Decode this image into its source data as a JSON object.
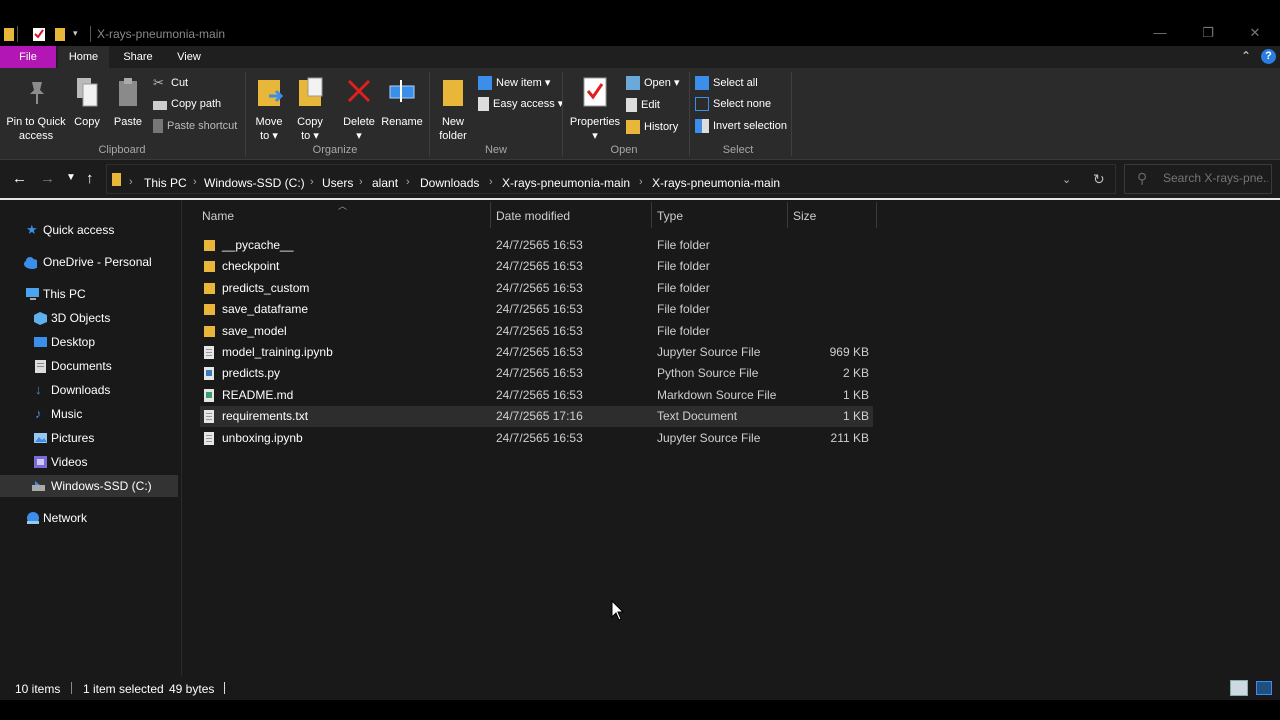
{
  "window": {
    "title": "X-rays-pneumonia-main"
  },
  "ribbon_tabs": {
    "file": "File",
    "home": "Home",
    "share": "Share",
    "view": "View"
  },
  "ribbon": {
    "clipboard": {
      "group": "Clipboard",
      "pin_line1": "Pin to Quick",
      "pin_line2": "access",
      "copy": "Copy",
      "paste": "Paste",
      "cut": "Cut",
      "copy_path": "Copy path",
      "paste_shortcut": "Paste shortcut"
    },
    "organize": {
      "group": "Organize",
      "move_to_line1": "Move",
      "move_to_line2": "to",
      "copy_to_line1": "Copy",
      "copy_to_line2": "to",
      "delete": "Delete",
      "rename": "Rename"
    },
    "new": {
      "group": "New",
      "new_folder_line1": "New",
      "new_folder_line2": "folder",
      "new_item": "New item",
      "easy_access": "Easy access"
    },
    "open": {
      "group": "Open",
      "properties": "Properties",
      "open": "Open",
      "edit": "Edit",
      "history": "History"
    },
    "select": {
      "group": "Select",
      "select_all": "Select all",
      "select_none": "Select none",
      "invert_selection": "Invert selection"
    }
  },
  "address": {
    "crumbs": [
      "This PC",
      "Windows-SSD (C:)",
      "Users",
      "alant",
      "Downloads",
      "X-rays-pneumonia-main",
      "X-rays-pneumonia-main"
    ],
    "search_placeholder": "Search X-rays-pne..."
  },
  "nav": {
    "quick_access": "Quick access",
    "onedrive": "OneDrive - Personal",
    "this_pc": "This PC",
    "objects3d": "3D Objects",
    "desktop": "Desktop",
    "documents": "Documents",
    "downloads": "Downloads",
    "music": "Music",
    "pictures": "Pictures",
    "videos": "Videos",
    "windows_ssd": "Windows-SSD (C:)",
    "network": "Network"
  },
  "columns": {
    "name": "Name",
    "date_modified": "Date modified",
    "type": "Type",
    "size": "Size"
  },
  "files": [
    {
      "name": "__pycache__",
      "date": "24/7/2565 16:53",
      "type": "File folder",
      "size": "",
      "kind": "folder"
    },
    {
      "name": "checkpoint",
      "date": "24/7/2565 16:53",
      "type": "File folder",
      "size": "",
      "kind": "folder"
    },
    {
      "name": "predicts_custom",
      "date": "24/7/2565 16:53",
      "type": "File folder",
      "size": "",
      "kind": "folder"
    },
    {
      "name": "save_dataframe",
      "date": "24/7/2565 16:53",
      "type": "File folder",
      "size": "",
      "kind": "folder"
    },
    {
      "name": "save_model",
      "date": "24/7/2565 16:53",
      "type": "File folder",
      "size": "",
      "kind": "folder"
    },
    {
      "name": "model_training.ipynb",
      "date": "24/7/2565 16:53",
      "type": "Jupyter Source File",
      "size": "969 KB",
      "kind": "doc"
    },
    {
      "name": "predicts.py",
      "date": "24/7/2565 16:53",
      "type": "Python Source File",
      "size": "2 KB",
      "kind": "py"
    },
    {
      "name": "README.md",
      "date": "24/7/2565 16:53",
      "type": "Markdown Source File",
      "size": "1 KB",
      "kind": "md"
    },
    {
      "name": "requirements.txt",
      "date": "24/7/2565 17:16",
      "type": "Text Document",
      "size": "1 KB",
      "kind": "doc"
    },
    {
      "name": "unboxing.ipynb",
      "date": "24/7/2565 16:53",
      "type": "Jupyter Source File",
      "size": "211 KB",
      "kind": "doc"
    }
  ],
  "selected_row": 8,
  "status": {
    "items": "10 items",
    "selected": "1 item selected",
    "size": "49 bytes"
  },
  "colors": {
    "file_tab": "#b217b5",
    "folder": "#e8b73a",
    "accent_blue": "#3b8eea"
  }
}
